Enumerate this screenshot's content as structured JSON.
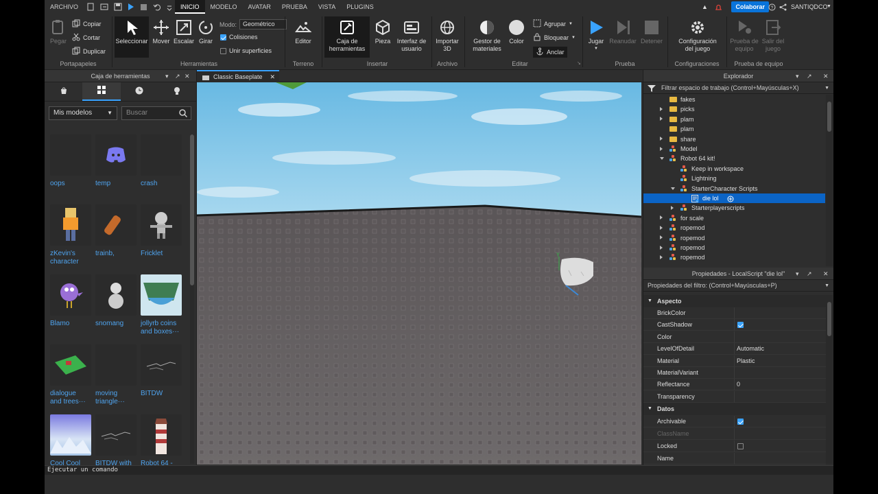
{
  "menubar": {
    "archivo": "ARCHIVO",
    "tabs": [
      "INICIO",
      "MODELO",
      "AVATAR",
      "PRUEBA",
      "VISTA",
      "PLUGINS"
    ],
    "collaborate": "Colaborar",
    "user": "SANTIQDCO"
  },
  "ribbon": {
    "portapapeles": {
      "paste": "Pegar",
      "copy": "Copiar",
      "cut": "Cortar",
      "duplicate": "Duplicar",
      "label": "Portapapeles"
    },
    "herramientas": {
      "select": "Seleccionar",
      "move": "Mover",
      "scale": "Escalar",
      "rotate": "Girar",
      "mode_label": "Modo:",
      "mode_value": "Geométrico",
      "collisions": "Colisiones",
      "join": "Unir superficies",
      "label": "Herramientas"
    },
    "terreno": {
      "editor": "Editor",
      "label": "Terreno"
    },
    "insertar": {
      "toolbox_l1": "Caja de",
      "toolbox_l2": "herramientas",
      "part": "Pieza",
      "ui_l1": "Interfaz de",
      "ui_l2": "usuario",
      "label": "Insertar"
    },
    "archivo": {
      "import_l1": "Importar",
      "import_l2": "3D",
      "label": "Archivo"
    },
    "editar": {
      "matmgr_l1": "Gestor de",
      "matmgr_l2": "materiales",
      "color": "Color",
      "group": "Agrupar",
      "lock": "Bloquear",
      "anchor": "Anclar",
      "label": "Editar"
    },
    "prueba": {
      "play": "Jugar",
      "resume": "Reanudar",
      "stop": "Detener",
      "label": "Prueba"
    },
    "configuraciones": {
      "settings_l1": "Configuración",
      "settings_l2": "del juego",
      "label": "Configuraciones"
    },
    "prueba_equipo": {
      "team_test_l1": "Prueba de",
      "team_test_l2": "equipo",
      "exit_l1": "Salir del",
      "exit_l2": "juego",
      "label": "Prueba de equipo"
    }
  },
  "toolbox": {
    "title": "Caja de herramientas",
    "category": "Mis modelos",
    "search_placeholder": "Buscar",
    "assets": [
      {
        "l1": "oops",
        "l2": ""
      },
      {
        "l1": "temp",
        "l2": ""
      },
      {
        "l1": "crash",
        "l2": ""
      },
      {
        "l1": "zKevin's",
        "l2": "character"
      },
      {
        "l1": "trainb,",
        "l2": ""
      },
      {
        "l1": "Fricklet",
        "l2": ""
      },
      {
        "l1": "Blamo",
        "l2": ""
      },
      {
        "l1": "snomang",
        "l2": ""
      },
      {
        "l1": "jollyrb coins",
        "l2": "and boxes···"
      },
      {
        "l1": "dialogue",
        "l2": "and trees···"
      },
      {
        "l1": "moving",
        "l2": "triangle···"
      },
      {
        "l1": "BITDW",
        "l2": ""
      },
      {
        "l1": "Cool Cool",
        "l2": ""
      },
      {
        "l1": "BITDW with",
        "l2": ""
      },
      {
        "l1": "Robot 64 -",
        "l2": ""
      }
    ]
  },
  "viewport": {
    "tab": "Classic Baseplate"
  },
  "explorer": {
    "title": "Explorador",
    "filter": "Filtrar espacio de trabajo (Control+Mayúsculas+X)",
    "items": [
      {
        "label": "fakes",
        "icon": "folder-icon",
        "arrow": "none"
      },
      {
        "label": "picks",
        "icon": "folder-icon",
        "arrow": "right"
      },
      {
        "label": "plam",
        "icon": "folder-icon",
        "arrow": "right"
      },
      {
        "label": "plam",
        "icon": "folder-icon",
        "arrow": "none"
      },
      {
        "label": "share",
        "icon": "folder-icon",
        "arrow": "right"
      },
      {
        "label": "Model",
        "icon": "model-icon",
        "arrow": "right"
      },
      {
        "label": "Robot 64 kit!",
        "icon": "model-icon",
        "arrow": "down"
      },
      {
        "label": "Keep in workspace",
        "icon": "model-icon",
        "arrow": "none"
      },
      {
        "label": "Lightning",
        "icon": "model-icon",
        "arrow": "none"
      },
      {
        "label": "StarterCharacter Scripts",
        "icon": "model-icon",
        "arrow": "down"
      },
      {
        "label": "die lol",
        "icon": "localscript-icon",
        "arrow": "none"
      },
      {
        "label": "Starterplayerscripts",
        "icon": "model-icon",
        "arrow": "right"
      },
      {
        "label": "for scale",
        "icon": "model-icon",
        "arrow": "right"
      },
      {
        "label": "ropemod",
        "icon": "model-icon",
        "arrow": "right"
      },
      {
        "label": "ropemod",
        "icon": "model-icon",
        "arrow": "right"
      },
      {
        "label": "ropemod",
        "icon": "model-icon",
        "arrow": "right"
      },
      {
        "label": "ropemod",
        "icon": "model-icon",
        "arrow": "right"
      }
    ]
  },
  "properties": {
    "title": "Propiedades - LocalScript \"die lol\"",
    "filter": "Propiedades del filtro: (Control+Mayúsculas+P)",
    "cat_aspecto": "Aspecto",
    "cat_datos": "Datos",
    "aspecto": [
      {
        "name": "BrickColor",
        "value": ""
      },
      {
        "name": "CastShadow",
        "value": ""
      },
      {
        "name": "Color",
        "value": ""
      },
      {
        "name": "LevelOfDetail",
        "value": "Automatic"
      },
      {
        "name": "Material",
        "value": "Plastic"
      },
      {
        "name": "MaterialVariant",
        "value": ""
      },
      {
        "name": "Reflectance",
        "value": "0"
      },
      {
        "name": "Transparency",
        "value": ""
      }
    ],
    "datos": [
      {
        "name": "Archivable",
        "value": ""
      },
      {
        "name": "ClassName",
        "value": ""
      },
      {
        "name": "Locked",
        "value": ""
      },
      {
        "name": "Name",
        "value": ""
      }
    ]
  },
  "command": {
    "placeholder": "Ejecutar un comando"
  },
  "colors": {
    "accent": "#3aa3ff",
    "selection": "#0b64c6",
    "link": "#4fa4ef",
    "collab": "#0a74da"
  }
}
